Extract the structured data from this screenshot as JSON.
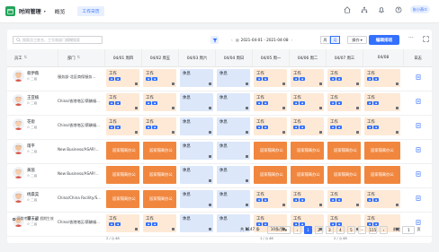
{
  "app": {
    "title": "时间管理",
    "nav_overview": "概览",
    "tab": "工作日历",
    "user": "张小燕①"
  },
  "toolbar": {
    "search_placeholder": "搜索员工姓名、工号和部门模糊搜索",
    "date_range": "2021-04-01 - 2021-04-08",
    "view_week": "周",
    "view_month": "月",
    "ops": "操作",
    "edit_button": "编辑排班",
    "more": "···"
  },
  "columns": {
    "employee": "员工",
    "department": "部门",
    "log": "日志",
    "dates": [
      "04/01 周四",
      "04/02 周五",
      "04/03 周六",
      "04/04 周日",
      "04/05 周一",
      "04/06 周二",
      "04/07 周三",
      "04/08"
    ]
  },
  "rows": [
    {
      "name": "叙伊薇",
      "sub": "二级",
      "dept": "服务部-北区商保服务...",
      "cells": [
        "work",
        "work",
        "rest",
        "rest",
        "work",
        "work",
        "work",
        "work"
      ]
    },
    {
      "name": "王亚楠",
      "sub": "二级",
      "dept": "China/香港地区/薪酬福...",
      "cells": [
        "work",
        "work",
        "rest",
        "rest",
        "work",
        "work",
        "work",
        "work"
      ]
    },
    {
      "name": "花街",
      "sub": "二级",
      "dept": "China/香港地区/薪酬福...",
      "cells": [
        "work",
        "work",
        "rest",
        "rest",
        "work",
        "work",
        "work",
        "work"
      ]
    },
    {
      "name": "雨平",
      "sub": "二级",
      "dept": "New Business/ASAP/...",
      "cells": [
        "home",
        "home",
        "rest",
        "rest",
        "home",
        "home",
        "home",
        "home"
      ]
    },
    {
      "name": "黄茵",
      "sub": "二级",
      "dept": "New Business/ASAP/...",
      "cells": [
        "home",
        "home",
        "rest",
        "rest",
        "home",
        "home",
        "home",
        "home"
      ]
    },
    {
      "name": "杨晨昊",
      "sub": "二级",
      "dept": "China/China Facility/S...",
      "cells": [
        "home",
        "home",
        "rest",
        "rest",
        "work",
        "work",
        "work",
        "work"
      ]
    },
    {
      "name": "谭天骏",
      "sub": "二级",
      "dept": "China/香港地区/薪酬福...",
      "cells": [
        "work",
        "work",
        "rest",
        "rest",
        "work",
        "work",
        "work",
        "work"
      ]
    }
  ],
  "cell_labels": {
    "work": "工作",
    "rest": "休息",
    "home": "居家隔离办公"
  },
  "summary": {
    "a": "2 / ◷ 48",
    "b": "1 / ◷ 48",
    "c": "2 / ◷ 48"
  },
  "legend": {
    "a": "异常考勤",
    "b": "假期生效"
  },
  "pager": {
    "total": "共 1147 条",
    "page_size": "10条/页",
    "pages": [
      "1",
      "2",
      "3",
      "4",
      "5",
      "···",
      "115"
    ],
    "goto_label": "前往",
    "goto_value": "1",
    "goto_suffix": "页"
  },
  "colors": {
    "accent": "#3370ff",
    "work": "#fde9d6",
    "rest": "#dce7fa",
    "home": "#f1873f"
  }
}
